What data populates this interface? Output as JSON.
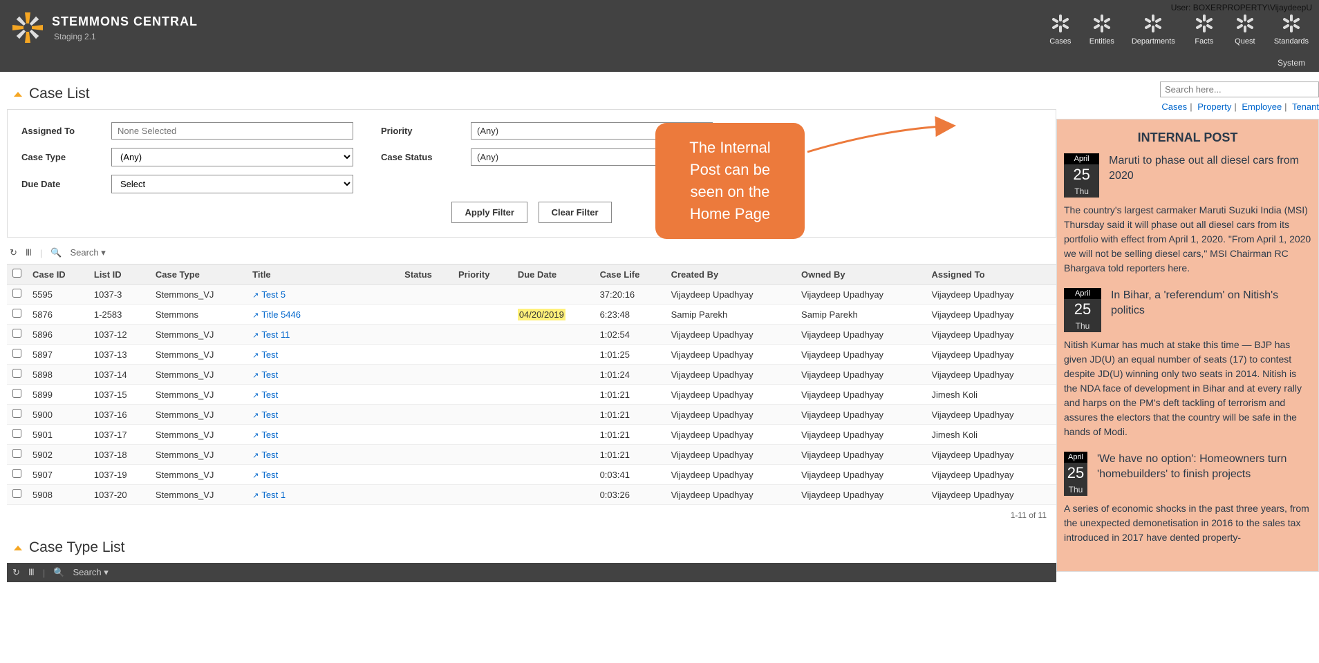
{
  "user_label": "User: BOXERPROPERTY\\VijaydeepU",
  "brand": {
    "title": "STEMMONS CENTRAL",
    "sub": "Staging 2.1"
  },
  "nav": {
    "cases": "Cases",
    "entities": "Entities",
    "departments": "Departments",
    "facts": "Facts",
    "quest": "Quest",
    "standards": "Standards"
  },
  "system_label": "System",
  "search": {
    "placeholder": "Search here...",
    "tab_cases": "Cases",
    "tab_property": "Property",
    "tab_employee": "Employee",
    "tab_tenant": "Tenant"
  },
  "case_list": {
    "title": "Case List"
  },
  "filters": {
    "assigned_to_lbl": "Assigned To",
    "assigned_to_val": "None Selected",
    "priority_lbl": "Priority",
    "priority_val": "(Any)",
    "case_type_lbl": "Case Type",
    "case_type_val": "(Any)",
    "case_status_lbl": "Case Status",
    "case_status_val": "(Any)",
    "due_date_lbl": "Due Date",
    "due_date_val": "Select",
    "apply_btn": "Apply Filter",
    "clear_btn": "Clear Filter"
  },
  "toolbar": {
    "search": "Search"
  },
  "cols": {
    "case_id": "Case ID",
    "list_id": "List ID",
    "case_type": "Case Type",
    "title": "Title",
    "status": "Status",
    "priority": "Priority",
    "due_date": "Due Date",
    "case_life": "Case Life",
    "created_by": "Created By",
    "owned_by": "Owned By",
    "assigned_to": "Assigned To"
  },
  "rows": [
    {
      "case_id": "5595",
      "list_id": "1037-3",
      "case_type": "Stemmons_VJ",
      "title": "Test 5",
      "status": "",
      "priority": "",
      "due_date": "",
      "case_life": "37:20:16",
      "created_by": "Vijaydeep Upadhyay",
      "owned_by": "Vijaydeep Upadhyay",
      "assigned_to": "Vijaydeep Upadhyay"
    },
    {
      "case_id": "5876",
      "list_id": "1-2583",
      "case_type": "Stemmons",
      "title": "Title 5446",
      "status": "",
      "priority": "",
      "due_date": "04/20/2019",
      "due_hl": true,
      "case_life": "6:23:48",
      "created_by": "Samip Parekh",
      "owned_by": "Samip Parekh",
      "assigned_to": "Vijaydeep Upadhyay"
    },
    {
      "case_id": "5896",
      "list_id": "1037-12",
      "case_type": "Stemmons_VJ",
      "title": "Test 11",
      "status": "",
      "priority": "",
      "due_date": "",
      "case_life": "1:02:54",
      "created_by": "Vijaydeep Upadhyay",
      "owned_by": "Vijaydeep Upadhyay",
      "assigned_to": "Vijaydeep Upadhyay"
    },
    {
      "case_id": "5897",
      "list_id": "1037-13",
      "case_type": "Stemmons_VJ",
      "title": "Test",
      "status": "",
      "priority": "",
      "due_date": "",
      "case_life": "1:01:25",
      "created_by": "Vijaydeep Upadhyay",
      "owned_by": "Vijaydeep Upadhyay",
      "assigned_to": "Vijaydeep Upadhyay"
    },
    {
      "case_id": "5898",
      "list_id": "1037-14",
      "case_type": "Stemmons_VJ",
      "title": "Test",
      "status": "",
      "priority": "",
      "due_date": "",
      "case_life": "1:01:24",
      "created_by": "Vijaydeep Upadhyay",
      "owned_by": "Vijaydeep Upadhyay",
      "assigned_to": "Vijaydeep Upadhyay"
    },
    {
      "case_id": "5899",
      "list_id": "1037-15",
      "case_type": "Stemmons_VJ",
      "title": "Test",
      "status": "",
      "priority": "",
      "due_date": "",
      "case_life": "1:01:21",
      "created_by": "Vijaydeep Upadhyay",
      "owned_by": "Vijaydeep Upadhyay",
      "assigned_to": "Jimesh Koli"
    },
    {
      "case_id": "5900",
      "list_id": "1037-16",
      "case_type": "Stemmons_VJ",
      "title": "Test",
      "status": "",
      "priority": "",
      "due_date": "",
      "case_life": "1:01:21",
      "created_by": "Vijaydeep Upadhyay",
      "owned_by": "Vijaydeep Upadhyay",
      "assigned_to": "Vijaydeep Upadhyay"
    },
    {
      "case_id": "5901",
      "list_id": "1037-17",
      "case_type": "Stemmons_VJ",
      "title": "Test",
      "status": "",
      "priority": "",
      "due_date": "",
      "case_life": "1:01:21",
      "created_by": "Vijaydeep Upadhyay",
      "owned_by": "Vijaydeep Upadhyay",
      "assigned_to": "Jimesh Koli"
    },
    {
      "case_id": "5902",
      "list_id": "1037-18",
      "case_type": "Stemmons_VJ",
      "title": "Test",
      "status": "",
      "priority": "",
      "due_date": "",
      "case_life": "1:01:21",
      "created_by": "Vijaydeep Upadhyay",
      "owned_by": "Vijaydeep Upadhyay",
      "assigned_to": "Vijaydeep Upadhyay"
    },
    {
      "case_id": "5907",
      "list_id": "1037-19",
      "case_type": "Stemmons_VJ",
      "title": "Test",
      "status": "",
      "priority": "",
      "due_date": "",
      "case_life": "0:03:41",
      "created_by": "Vijaydeep Upadhyay",
      "owned_by": "Vijaydeep Upadhyay",
      "assigned_to": "Vijaydeep Upadhyay"
    },
    {
      "case_id": "5908",
      "list_id": "1037-20",
      "case_type": "Stemmons_VJ",
      "title": "Test 1",
      "status": "",
      "priority": "",
      "due_date": "",
      "case_life": "0:03:26",
      "created_by": "Vijaydeep Upadhyay",
      "owned_by": "Vijaydeep Upadhyay",
      "assigned_to": "Vijaydeep Upadhyay"
    }
  ],
  "pager": "1-11 of 11",
  "case_type_list": {
    "title": "Case Type List"
  },
  "toolbar2": {
    "search": "Search"
  },
  "callout": "The Internal Post can be seen on the Home Page",
  "internal_post": {
    "header": "INTERNAL POST",
    "posts": [
      {
        "mon": "April",
        "day": "25",
        "dow": "Thu",
        "title": "Maruti to phase out all diesel cars from 2020",
        "body": "The country's largest carmaker Maruti Suzuki India (MSI) Thursday said it will phase out all diesel cars from its portfolio with effect from April 1, 2020. \"From April 1, 2020 we will not be selling diesel cars,\" MSI Chairman RC Bhargava told reporters here."
      },
      {
        "mon": "April",
        "day": "25",
        "dow": "Thu",
        "title": "In Bihar, a 'referendum' on Nitish's politics",
        "body": "Nitish Kumar has much at stake this time — BJP has given JD(U) an equal number of seats (17) to contest despite JD(U) winning only two seats in 2014. Nitish is the NDA face of development in Bihar and at every rally and harps on the PM's deft tackling of terrorism and assures the electors that the country will be safe in the hands of Modi."
      },
      {
        "mon": "April",
        "day": "25",
        "dow": "Thu",
        "title": "'We have no option': Homeowners turn 'homebuilders' to finish projects",
        "body": "A series of economic shocks in the past three years, from the unexpected demonetisation in 2016 to the sales tax introduced in 2017 have dented property-"
      }
    ]
  }
}
